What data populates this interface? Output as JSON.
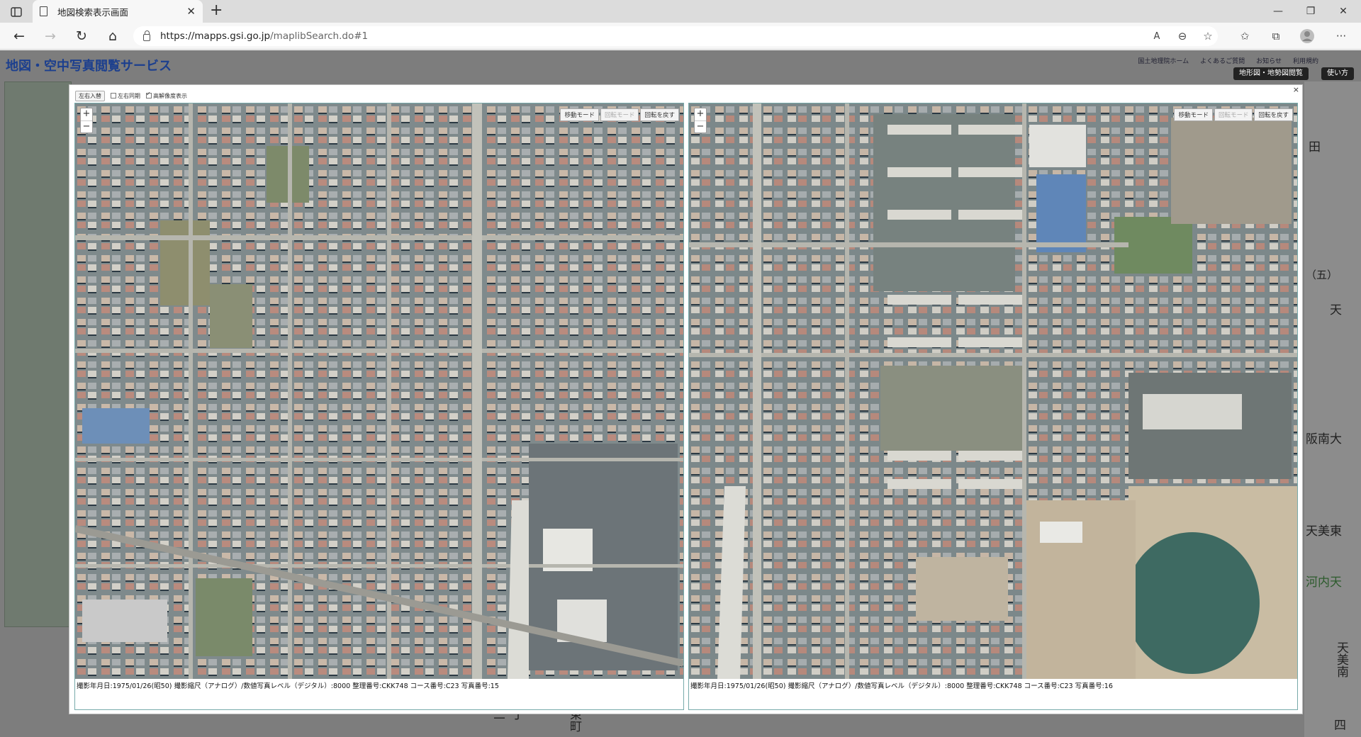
{
  "browser": {
    "tab_title": "地図検索表示画面",
    "url_host": "https://mapps.gsi.go.jp",
    "url_path": "/maplibSearch.do#1",
    "reader_label": "A"
  },
  "site": {
    "title": "地図・空中写真閲覧サービス",
    "top_links": [
      "国土地理院ホーム",
      "よくあるご質問",
      "お知らせ",
      "利用規約"
    ],
    "top_buttons": [
      "地形図・地勢図閲覧",
      "使い方"
    ]
  },
  "modal": {
    "close_label": "×",
    "top_button": "左右入替",
    "check_sync": "左右同期",
    "check_hires": "高解像度表示",
    "zoom_in": "+",
    "zoom_out": "−",
    "mode_move": "移動モード",
    "mode_rotate": "回転モード",
    "mode_reset": "回転を戻す",
    "left_caption": "撮影年月日:1975/01/26(昭50) 撮影縮尺（アナログ）/数値写真レベル（デジタル）:8000 整理番号:CKK748 コース番号:C23 写真番号:15",
    "right_caption": "撮影年月日:1975/01/26(昭50) 撮影縮尺（アナログ）/数値写真レベル（デジタル）:8000 整理番号:CKK748 コース番号:C23 写真番号:16"
  },
  "background_map": {
    "labels": [
      "田",
      "（五）",
      "天",
      "阪南大",
      "天美東",
      "河内天",
      "天美南",
      "四",
      "二",
      "丁",
      "東町"
    ]
  },
  "colors": {
    "site_title": "#1c3f8e",
    "panel_border": "#77aaaa"
  }
}
